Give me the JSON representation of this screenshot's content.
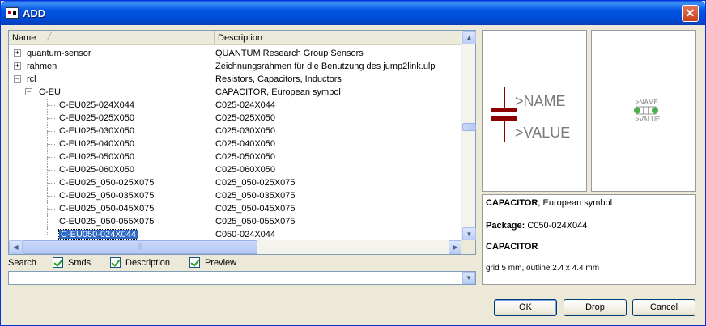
{
  "window": {
    "title": "ADD",
    "close": "✕"
  },
  "tree": {
    "columns": {
      "name": "Name",
      "description": "Description",
      "sort_icon": "sort-ascending"
    },
    "rows": [
      {
        "name": "quantum-sensor",
        "description": "QUANTUM Research Group Sensors",
        "level": 0,
        "toggle": "+"
      },
      {
        "name": "rahmen",
        "description": "Zeichnungsrahmen für die Benutzung des jump2link.ulp",
        "level": 0,
        "toggle": "+"
      },
      {
        "name": "rcl",
        "description": "Resistors, Capacitors, Inductors",
        "level": 0,
        "toggle": "−"
      },
      {
        "name": "C-EU",
        "description": "CAPACITOR, European symbol",
        "level": 1,
        "toggle": "−"
      },
      {
        "name": "C-EU025-024X044",
        "description": "C025-024X044",
        "level": 2
      },
      {
        "name": "C-EU025-025X050",
        "description": "C025-025X050",
        "level": 2
      },
      {
        "name": "C-EU025-030X050",
        "description": "C025-030X050",
        "level": 2
      },
      {
        "name": "C-EU025-040X050",
        "description": "C025-040X050",
        "level": 2
      },
      {
        "name": "C-EU025-050X050",
        "description": "C025-050X050",
        "level": 2
      },
      {
        "name": "C-EU025-060X050",
        "description": "C025-060X050",
        "level": 2
      },
      {
        "name": "C-EU025_050-025X075",
        "description": "C025_050-025X075",
        "level": 2
      },
      {
        "name": "C-EU025_050-035X075",
        "description": "C025_050-035X075",
        "level": 2
      },
      {
        "name": "C-EU025_050-045X075",
        "description": "C025_050-045X075",
        "level": 2
      },
      {
        "name": "C-EU025_050-055X075",
        "description": "C025_050-055X075",
        "level": 2
      },
      {
        "name": "C-EU050-024X044",
        "description": "C050-024X044",
        "level": 2,
        "selected": true
      }
    ]
  },
  "search": {
    "label": "Search",
    "value": "",
    "options": [
      {
        "label": "Smds",
        "checked": true
      },
      {
        "label": "Description",
        "checked": true
      },
      {
        "label": "Preview",
        "checked": true
      }
    ]
  },
  "preview": {
    "symbol_name": ">NAME",
    "symbol_value": ">VALUE",
    "package_name": ">NAME",
    "package_value": ">VALUE",
    "symbol_color": "#8b0000",
    "label_color": "#7a7a7a",
    "pad_color": "#4caf50"
  },
  "info": {
    "title_bold": "CAPACITOR",
    "title_rest": ", European symbol",
    "package_label": "Package:",
    "package_value": "C050-024X044",
    "heading": "CAPACITOR",
    "detail": "grid 5 mm, outline 2.4 x 4.4 mm"
  },
  "buttons": {
    "ok": "OK",
    "drop": "Drop",
    "cancel": "Cancel"
  }
}
